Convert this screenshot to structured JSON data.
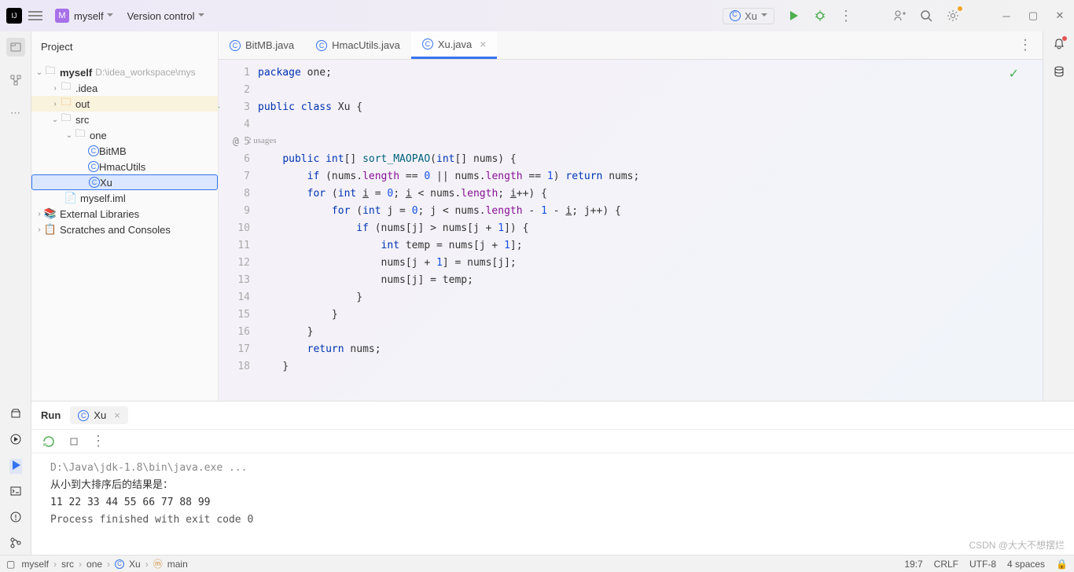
{
  "header": {
    "project_name": "myself",
    "vcs_label": "Version control",
    "run_config": "Xu"
  },
  "project_panel": {
    "title": "Project",
    "root": "myself",
    "root_path": "D:\\idea_workspace\\mys",
    "idea_dir": ".idea",
    "out_dir": "out",
    "src_dir": "src",
    "pkg": "one",
    "cls1": "BitMB",
    "cls2": "HmacUtils",
    "cls3": "Xu",
    "iml": "myself.iml",
    "ext_lib": "External Libraries",
    "scratches": "Scratches and Consoles"
  },
  "tabs": {
    "t1": "BitMB.java",
    "t2": "HmacUtils.java",
    "t3": "Xu.java"
  },
  "editor": {
    "usages": "2 usages",
    "lines": [
      "package one;",
      "",
      "public class Xu {",
      "",
      "",
      "    public int[] sort_MAOPAO(int[] nums) {",
      "        if (nums.length == 0 || nums.length == 1) return nums;",
      "        for (int i = 0; i < nums.length; i++) {",
      "            for (int j = 0; j < nums.length - 1 - i; j++) {",
      "                if (nums[j] > nums[j + 1]) {",
      "                    int temp = nums[j + 1];",
      "                    nums[j + 1] = nums[j];",
      "                    nums[j] = temp;",
      "                }",
      "            }",
      "        }",
      "        return nums;",
      "    }",
      ""
    ]
  },
  "run": {
    "title": "Run",
    "tab": "Xu",
    "out1": "D:\\Java\\jdk-1.8\\bin\\java.exe ...",
    "out2": "从小到大排序后的结果是：",
    "out3": "11 22 33 44 55 66 77 88 99",
    "out4": "Process finished with exit code 0"
  },
  "breadcrumb": {
    "c1": "myself",
    "c2": "src",
    "c3": "one",
    "c4": "Xu",
    "c5": "main"
  },
  "status": {
    "pos": "19:7",
    "eol": "CRLF",
    "enc": "UTF-8",
    "indent": "4 spaces"
  },
  "watermark": "CSDN @大大不想摆烂"
}
